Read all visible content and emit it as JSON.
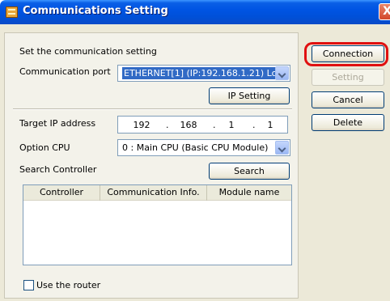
{
  "window": {
    "title": "Communications Setting",
    "close_glyph": "X"
  },
  "form": {
    "heading": "Set the communication setting",
    "comm_port_label": "Communication port",
    "comm_port_value": "ETHERNET[1]  (IP:192.168.1.21) Lo",
    "ip_setting_button": "IP Setting",
    "target_ip_label": "Target IP address",
    "target_ip": [
      "192",
      "168",
      "1",
      "1"
    ],
    "option_cpu_label": "Option CPU",
    "option_cpu_value": "0 : Main CPU (Basic CPU Module)",
    "search_controller_label": "Search Controller",
    "search_button": "Search",
    "table_headers": [
      "Controller",
      "Communication Info.",
      "Module name"
    ],
    "table_rows": [],
    "use_router_label": "Use the router",
    "use_router_checked": false
  },
  "buttons": {
    "connection": "Connection",
    "setting": "Setting",
    "cancel": "Cancel",
    "delete": "Delete"
  },
  "highlight_color": "#e01010"
}
